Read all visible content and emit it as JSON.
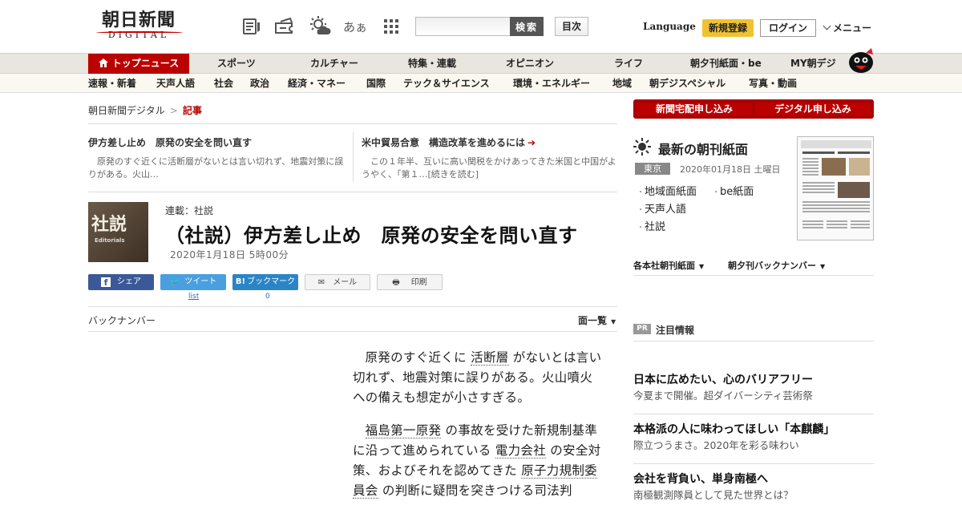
{
  "header": {
    "logo_jp": "朝日新聞",
    "logo_en": "DIGITAL",
    "search_button": "検索",
    "search_placeholder": "",
    "mokuji": "目次",
    "language": "Language",
    "signup": "新規登録",
    "login": "ログイン",
    "menu": "メニュー",
    "font_icon_text": "あぁ"
  },
  "nav_primary": [
    "トップニュース",
    "スポーツ",
    "カルチャー",
    "特集・連載",
    "オピニオン",
    "ライフ",
    "朝夕刊紙面・be",
    "MY朝デジ"
  ],
  "nav_secondary": [
    "速報・新着",
    "天声人語",
    "社会",
    "政治",
    "経済・マネー",
    "国際",
    "テック＆サイエンス",
    "環境・エネルギー",
    "地域",
    "朝デジスペシャル",
    "写真・動画"
  ],
  "breadcrumb": {
    "home": "朝日新聞デジタル",
    "sep": ">",
    "current": "記事"
  },
  "related": [
    {
      "title": "伊方差し止め　原発の安全を問い直す",
      "desc": "原発のすぐ近くに活断層がないとは言い切れず、地震対策に誤りがある。火山…"
    },
    {
      "title": "米中貿易合意　構造改革を進めるには",
      "desc": "この１年半、互いに高い関税をかけあってきた米国と中国がようやく、「第１…[続きを読む]"
    }
  ],
  "article": {
    "badge_kanji": "社説",
    "badge_en": "Editorials",
    "series": "連載：社説",
    "title": "（社説）伊方差し止め　原発の安全を問い直す",
    "date": "2020年1月18日 5時00分",
    "body_p1_a": "原発のすぐ近くに ",
    "body_p1_link": "活断層",
    "body_p1_b": " がないとは言い切れず、地震対策に誤りがある。火山噴火への備えも想定が小さすぎる。",
    "body_p2_link1": "福島第一原発",
    "body_p2_a": " の事故を受けた新規制基準に沿って進められている ",
    "body_p2_link2": "電力会社",
    "body_p2_b": " の安全対策、およびそれを認めてきた ",
    "body_p2_link3": "原子力規制委員会",
    "body_p2_c": " の判断に疑問を突きつける司法判"
  },
  "share": {
    "facebook": "シェア",
    "twitter": "ツイート",
    "hatena": "ブックマーク",
    "mail": "メール",
    "print": "印刷",
    "twitter_count": "list",
    "hatena_count": "0"
  },
  "backnumber": "バックナンバー",
  "menlist": "面一覧",
  "right": {
    "sub_home": "新聞宅配申し込み",
    "sub_digital": "デジタル申し込み",
    "choukan_title": "最新の朝刊紙面",
    "region": "東京",
    "choukan_date": "2020年01月18日 土曜日",
    "links": [
      "地域面紙面",
      "be紙面",
      "天声人語",
      "社説"
    ],
    "dd1": "各本社朝刊紙面",
    "dd2": "朝夕刊バックナンバー",
    "pr_badge": "PR",
    "pr_title": "注目情報",
    "pr_items": [
      {
        "title": "日本に広めたい、心のバリアフリー",
        "sub": "今夏まで開催。超ダイバーシティ芸術祭"
      },
      {
        "title": "本格派の人に味わってほしい「本麒麟」",
        "sub": "際立つうまさ。2020年を彩る味わい"
      },
      {
        "title": "会社を背負い、単身南極へ",
        "sub": "南極観測隊員として見た世界とは？"
      }
    ]
  },
  "colors": {
    "brand_red": "#b00",
    "signup_yellow": "#f0c230",
    "facebook": "#3b5998",
    "twitter": "#4a9fe0",
    "hatena": "#2b85c5"
  }
}
